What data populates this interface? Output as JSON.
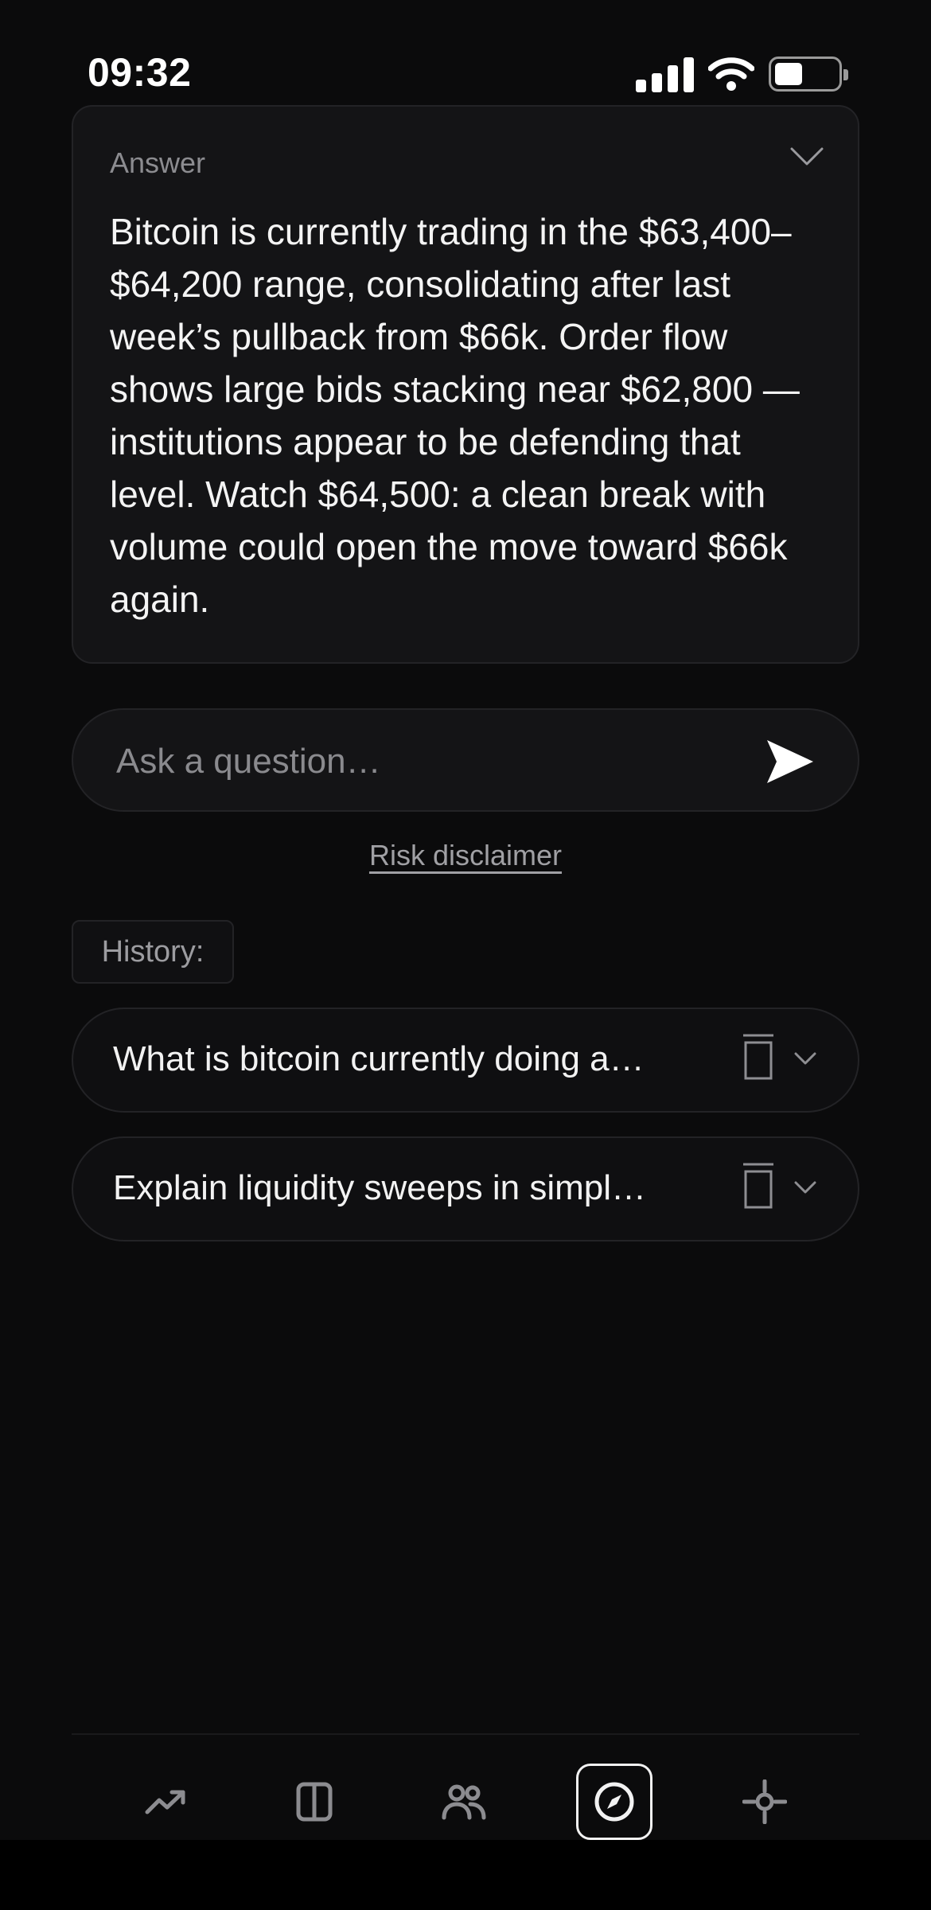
{
  "status_bar": {
    "time": "09:32"
  },
  "answer": {
    "label": "Answer",
    "text": "Bitcoin is currently trading in the $63,400–$64,200 range, consolidating after last week’s pullback from $66k. Order flow shows large bids stacking near $62,800 — institutions appear to be defending that level. Watch $64,500: a clean break with volume could open the move toward $66k again."
  },
  "ask": {
    "placeholder": "Ask a question…"
  },
  "risk_disclaimer": "Risk disclaimer",
  "history": {
    "label": "History:",
    "items": [
      {
        "question": "What is bitcoin currently doing a…"
      },
      {
        "question": "Explain liquidity sweeps in simpl…"
      }
    ]
  },
  "tabs": [
    {
      "icon": "trending-up-icon",
      "active": false
    },
    {
      "icon": "columns-icon",
      "active": false
    },
    {
      "icon": "users-icon",
      "active": false
    },
    {
      "icon": "compass-icon",
      "active": true
    },
    {
      "icon": "crosshair-icon",
      "active": false
    }
  ],
  "colors": {
    "background": "#0b0b0c",
    "card": "#141416",
    "border": "#232326",
    "muted": "#8c8c90"
  }
}
